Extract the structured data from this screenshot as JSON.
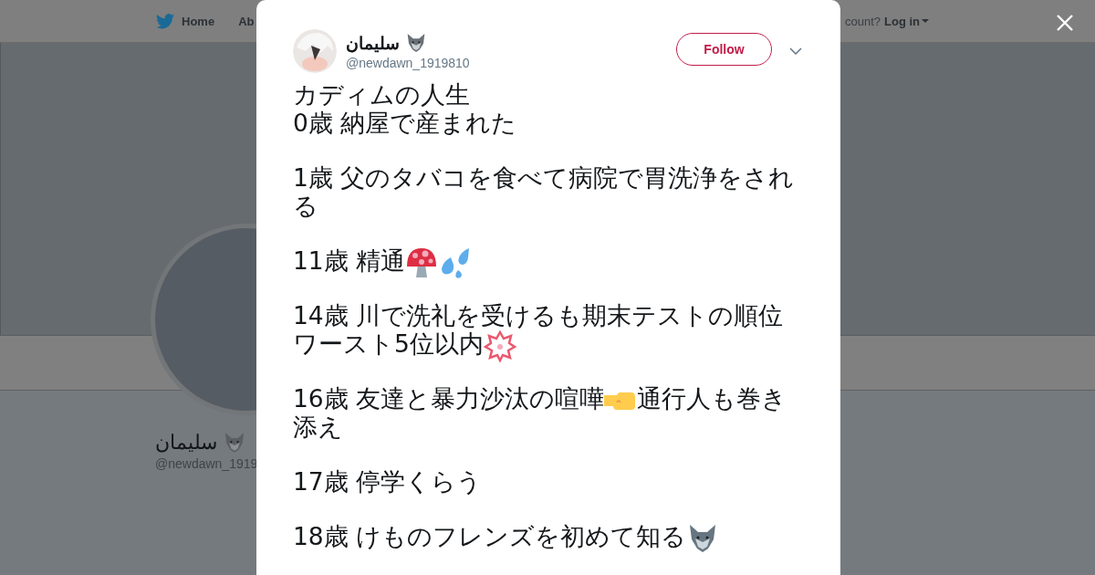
{
  "nav": {
    "items": [
      "Home",
      "Ab"
    ],
    "account_prompt": "count?",
    "login": "Log in"
  },
  "profile": {
    "name": "سليمان",
    "handle": "@newdawn_1919"
  },
  "tweet": {
    "name": "سليمان",
    "handle": "@newdawn_1919810",
    "follow": "Follow",
    "paragraphs": [
      {
        "lines": [
          {
            "parts": [
              {
                "kind": "text",
                "text": "カディムの人生"
              }
            ]
          },
          {
            "parts": [
              {
                "kind": "text",
                "text": "0歳 納屋で産まれた"
              }
            ]
          }
        ]
      },
      {
        "lines": [
          {
            "parts": [
              {
                "kind": "text",
                "text": "1歳 父のタバコを食べて病院で胃洗浄をされ"
              }
            ]
          },
          {
            "parts": [
              {
                "kind": "text",
                "text": "る"
              }
            ]
          }
        ]
      },
      {
        "lines": [
          {
            "parts": [
              {
                "kind": "text",
                "text": "11歳 精通"
              },
              {
                "kind": "mushroom"
              },
              {
                "kind": "sweat"
              }
            ]
          }
        ]
      },
      {
        "lines": [
          {
            "parts": [
              {
                "kind": "text",
                "text": "14歳 川で洗礼を受けるも期末テストの順位"
              }
            ]
          },
          {
            "parts": [
              {
                "kind": "text",
                "text": "ワースト5位以内"
              },
              {
                "kind": "blossom"
              }
            ]
          }
        ]
      },
      {
        "lines": [
          {
            "parts": [
              {
                "kind": "text",
                "text": "16歳 友達と暴力沙汰の喧嘩"
              },
              {
                "kind": "fist"
              },
              {
                "kind": "text",
                "text": "通行人も巻き"
              }
            ]
          },
          {
            "parts": [
              {
                "kind": "text",
                "text": "添え"
              }
            ]
          }
        ]
      },
      {
        "lines": [
          {
            "parts": [
              {
                "kind": "text",
                "text": "17歳 停学くらう"
              }
            ]
          }
        ]
      },
      {
        "lines": [
          {
            "parts": [
              {
                "kind": "text",
                "text": "18歳 けものフレンズを初めて知る"
              },
              {
                "kind": "wolf"
              }
            ]
          }
        ]
      }
    ]
  }
}
